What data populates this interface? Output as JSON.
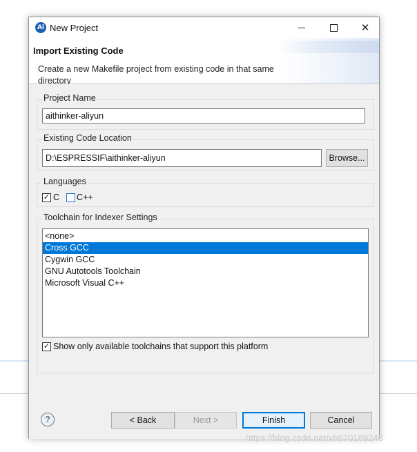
{
  "window": {
    "title": "New Project",
    "app_icon_text": "Ai",
    "minimize_icon": "minimize-icon",
    "maximize_icon": "maximize-icon",
    "close_icon": "close-icon",
    "close_glyph": "✕"
  },
  "header": {
    "title": "Import Existing Code",
    "description": "Create a new Makefile project from existing code in that same directory"
  },
  "project_name": {
    "label": "Project Name",
    "value": "aithinker-aliyun"
  },
  "code_location": {
    "label": "Existing Code Location",
    "value": "D:\\ESPRESSIF\\aithinker-aliyun",
    "browse_label": "Browse..."
  },
  "languages": {
    "label": "Languages",
    "items": [
      {
        "label": "C",
        "checked": true
      },
      {
        "label": "C++",
        "checked": false
      }
    ]
  },
  "toolchain": {
    "label": "Toolchain for Indexer Settings",
    "items": [
      {
        "label": "<none>",
        "selected": false
      },
      {
        "label": "Cross GCC",
        "selected": true
      },
      {
        "label": "Cygwin GCC",
        "selected": false
      },
      {
        "label": "GNU Autotools Toolchain",
        "selected": false
      },
      {
        "label": "Microsoft Visual C++",
        "selected": false
      }
    ],
    "show_only_available": {
      "label": "Show only available toolchains that support this platform",
      "checked": true
    }
  },
  "footer": {
    "help_glyph": "?",
    "back_label": "< Back",
    "next_label": "Next >",
    "finish_label": "Finish",
    "cancel_label": "Cancel"
  },
  "watermark": "https://blog.csdn.net/xh870189248",
  "colors": {
    "selection": "#0078d7",
    "dialog_bg": "#f0f0f0",
    "default_button_border": "#0078d7"
  }
}
